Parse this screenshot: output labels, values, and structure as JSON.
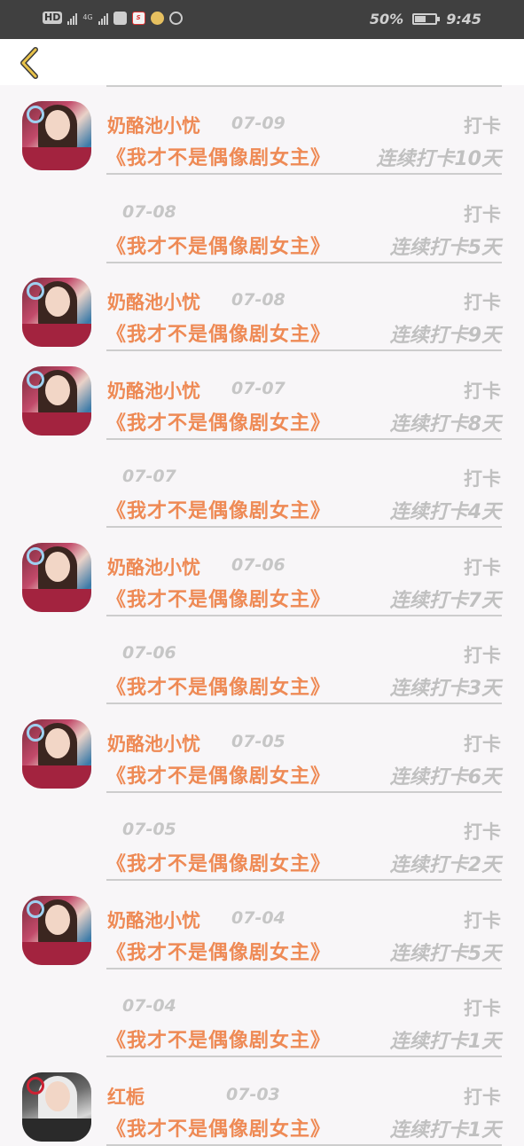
{
  "status_bar": {
    "badge": "HD",
    "network": "4G",
    "battery": "50%",
    "time": "9:45",
    "icons": [
      "hd-icon",
      "signal-icon",
      "signal-4g-icon",
      "qq-icon",
      "sina-icon",
      "assistant-icon",
      "location-icon",
      "battery-icon"
    ]
  },
  "header": {
    "back_icon": "chevron-left-icon"
  },
  "colors": {
    "accent": "#ee8a55",
    "muted": "#c0c0c0",
    "background": "#f8f6f8"
  },
  "rows": [
    {
      "avatar": "girl",
      "name": "奶酪池小忧",
      "date": "07-09",
      "type": "打卡",
      "title": "《我才不是偶像剧女主》",
      "streak": "连续打卡10天"
    },
    {
      "avatar": "",
      "name": "",
      "date": "07-08",
      "type": "打卡",
      "title": "《我才不是偶像剧女主》",
      "streak": "连续打卡5天"
    },
    {
      "avatar": "girl",
      "name": "奶酪池小忧",
      "date": "07-08",
      "type": "打卡",
      "title": "《我才不是偶像剧女主》",
      "streak": "连续打卡9天"
    },
    {
      "avatar": "girl",
      "name": "奶酪池小忧",
      "date": "07-07",
      "type": "打卡",
      "title": "《我才不是偶像剧女主》",
      "streak": "连续打卡8天"
    },
    {
      "avatar": "",
      "name": "",
      "date": "07-07",
      "type": "打卡",
      "title": "《我才不是偶像剧女主》",
      "streak": "连续打卡4天"
    },
    {
      "avatar": "girl",
      "name": "奶酪池小忧",
      "date": "07-06",
      "type": "打卡",
      "title": "《我才不是偶像剧女主》",
      "streak": "连续打卡7天"
    },
    {
      "avatar": "",
      "name": "",
      "date": "07-06",
      "type": "打卡",
      "title": "《我才不是偶像剧女主》",
      "streak": "连续打卡3天"
    },
    {
      "avatar": "girl",
      "name": "奶酪池小忧",
      "date": "07-05",
      "type": "打卡",
      "title": "《我才不是偶像剧女主》",
      "streak": "连续打卡6天"
    },
    {
      "avatar": "",
      "name": "",
      "date": "07-05",
      "type": "打卡",
      "title": "《我才不是偶像剧女主》",
      "streak": "连续打卡2天"
    },
    {
      "avatar": "girl",
      "name": "奶酪池小忧",
      "date": "07-04",
      "type": "打卡",
      "title": "《我才不是偶像剧女主》",
      "streak": "连续打卡5天"
    },
    {
      "avatar": "",
      "name": "",
      "date": "07-04",
      "type": "打卡",
      "title": "《我才不是偶像剧女主》",
      "streak": "连续打卡1天"
    },
    {
      "avatar": "anime",
      "name": "红栀",
      "date": "07-03",
      "type": "打卡",
      "title": "《我才不是偶像剧女主》",
      "streak": "连续打卡1天"
    }
  ]
}
